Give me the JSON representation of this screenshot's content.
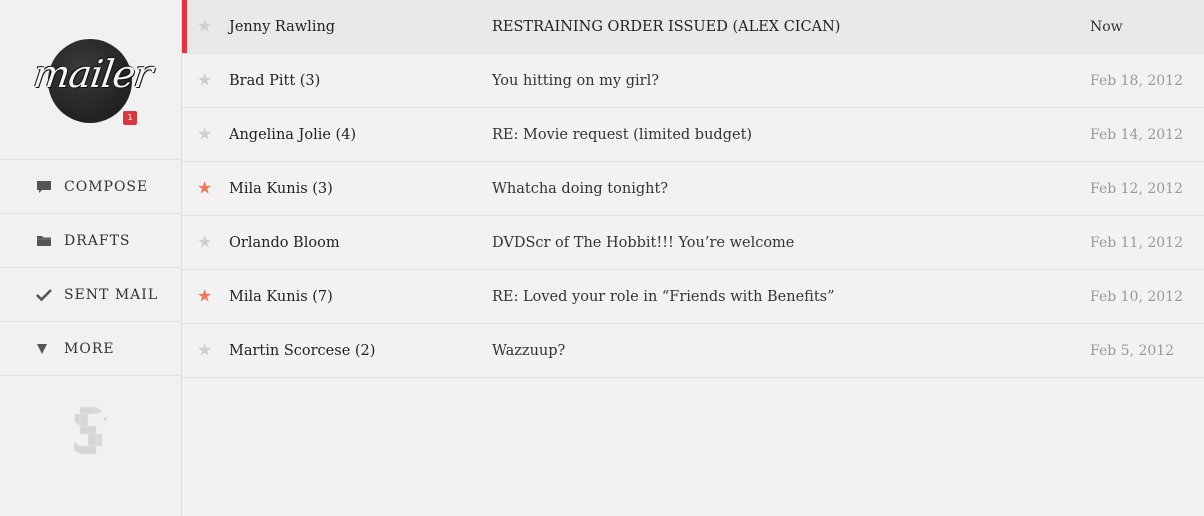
{
  "logo": {
    "text": "mailer",
    "badge_count": "1"
  },
  "sidebar": {
    "items": [
      {
        "label": "COMPOSE",
        "icon": "speech-bubble-icon"
      },
      {
        "label": "DRAFTS",
        "icon": "folder-icon"
      },
      {
        "label": "SENT MAIL",
        "icon": "checkmark-icon"
      },
      {
        "label": "MORE",
        "icon": "triangle-down-icon"
      }
    ]
  },
  "colors": {
    "accent_red": "#e4363f",
    "star_on": "#ee7a57",
    "star_off": "#cfcfcf",
    "badge": "#d8383c"
  },
  "messages": [
    {
      "sender": "Jenny Rawling",
      "subject": "RESTRAINING ORDER ISSUED (ALEX CICAN)",
      "date": "Now",
      "starred": false,
      "active": true
    },
    {
      "sender": "Brad Pitt (3)",
      "subject": "You hitting on my girl?",
      "date": "Feb 18, 2012",
      "starred": false,
      "active": false
    },
    {
      "sender": "Angelina Jolie (4)",
      "subject": "RE: Movie request (limited budget)",
      "date": "Feb 14, 2012",
      "starred": false,
      "active": false
    },
    {
      "sender": "Mila Kunis (3)",
      "subject": "Whatcha doing tonight?",
      "date": "Feb 12, 2012",
      "starred": true,
      "active": false
    },
    {
      "sender": "Orlando Bloom",
      "subject": "DVDScr of The Hobbit!!! You’re welcome",
      "date": "Feb 11, 2012",
      "starred": false,
      "active": false
    },
    {
      "sender": "Mila Kunis (7)",
      "subject": "RE: Loved your role in “Friends with Benefits”",
      "date": "Feb 10, 2012",
      "starred": true,
      "active": false
    },
    {
      "sender": "Martin Scorcese (2)",
      "subject": "Wazzuup?",
      "date": "Feb 5, 2012",
      "starred": false,
      "active": false
    }
  ]
}
